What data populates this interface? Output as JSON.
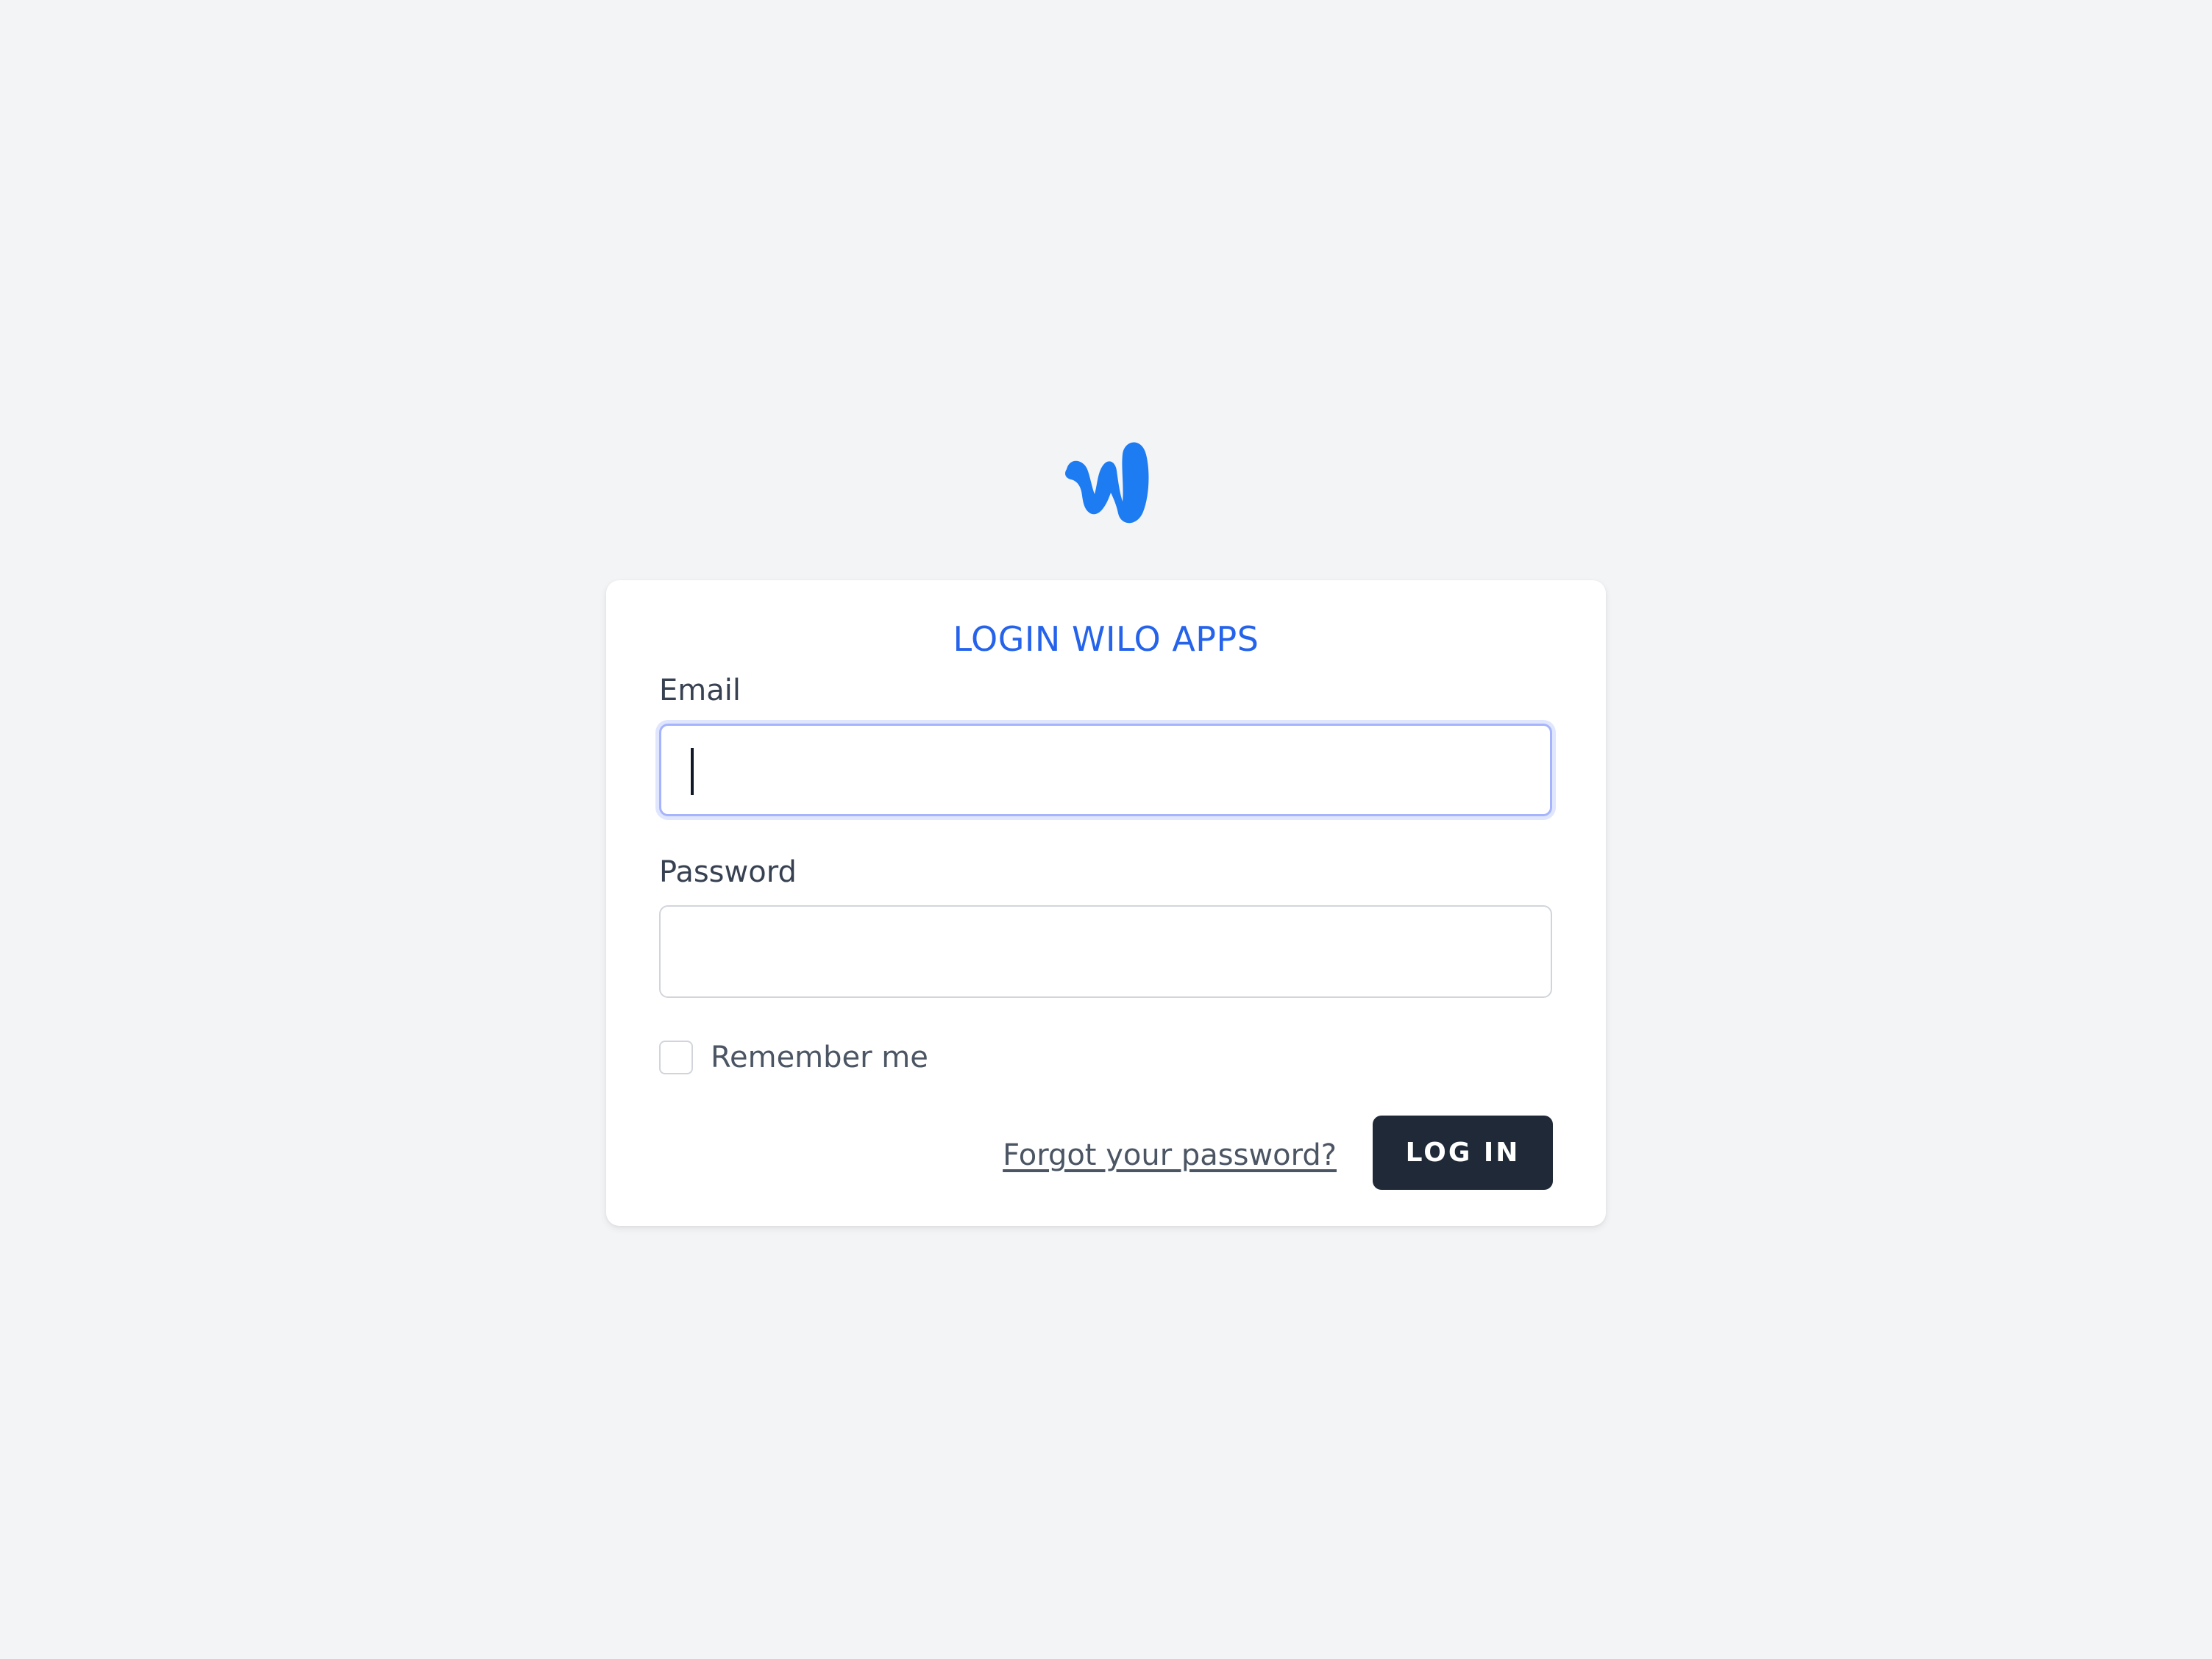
{
  "logo": {
    "icon": "wilo-w-logo",
    "color": "#1d7cf2"
  },
  "card": {
    "title": "LOGIN WILO APPS",
    "title_color": "#2563eb"
  },
  "form": {
    "email_label": "Email",
    "email_value": "",
    "password_label": "Password",
    "password_value": "",
    "remember_label": "Remember me",
    "remember_checked": false,
    "forgot_link": "Forgot your password?",
    "login_button": "LOG IN",
    "button_color": "#1f2937"
  }
}
